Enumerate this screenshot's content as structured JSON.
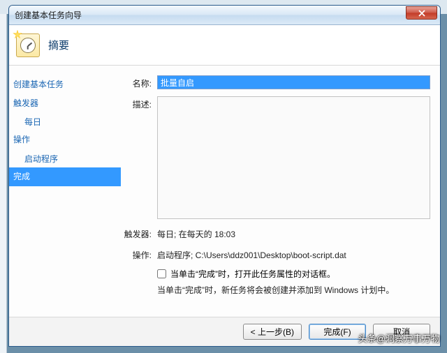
{
  "window": {
    "title": "创建基本任务向导"
  },
  "header": {
    "title": "摘要"
  },
  "sidebar": {
    "items": [
      {
        "label": "创建基本任务",
        "sub": false
      },
      {
        "label": "触发器",
        "sub": false
      },
      {
        "label": "每日",
        "sub": true
      },
      {
        "label": "操作",
        "sub": false
      },
      {
        "label": "启动程序",
        "sub": true
      },
      {
        "label": "完成",
        "sub": false,
        "selected": true
      }
    ]
  },
  "form": {
    "name_label": "名称:",
    "name_value": "批量自启",
    "desc_label": "描述:",
    "desc_value": "",
    "trigger_label": "触发器:",
    "trigger_value": "每日; 在每天的 18:03",
    "action_label": "操作:",
    "action_value": "启动程序; C:\\Users\\ddz001\\Desktop\\boot-script.dat",
    "checkbox_label": "当单击“完成”时，打开此任务属性的对话框。",
    "info_line": "当单击“完成”时，新任务将会被创建并添加到 Windows 计划中。"
  },
  "buttons": {
    "back": "< 上一步(B)",
    "finish": "完成(F)",
    "cancel": "取消"
  },
  "watermark": "头条@洞察万事万物"
}
